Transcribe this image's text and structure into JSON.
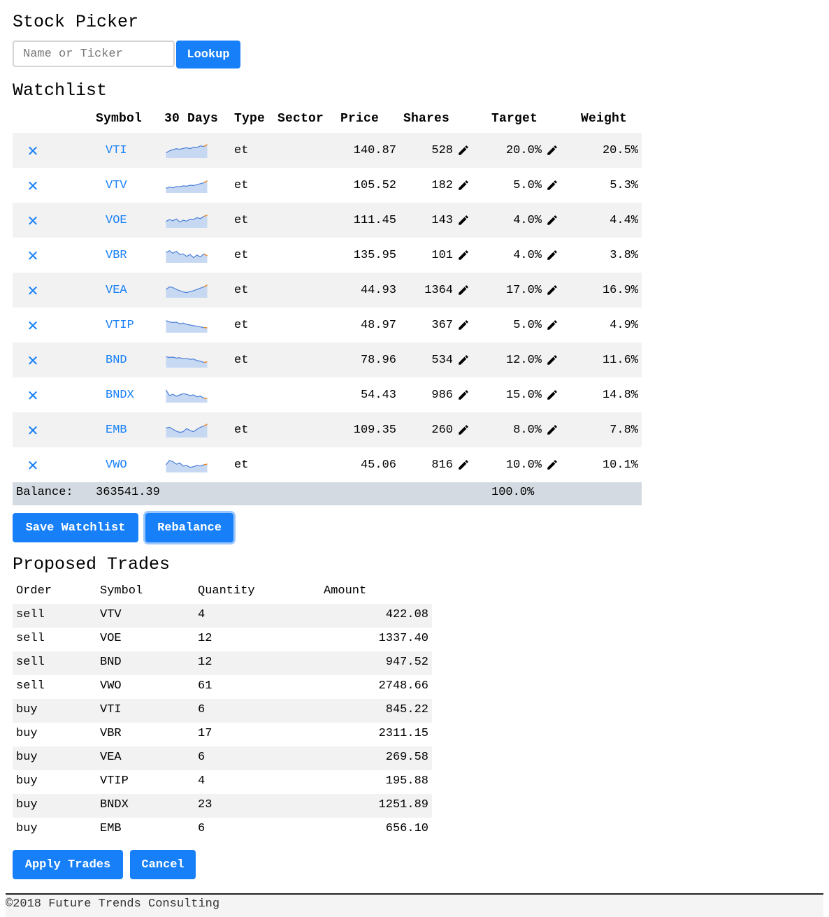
{
  "app": {
    "title": "Stock Picker",
    "search": {
      "placeholder": "Name or Ticker",
      "value": ""
    },
    "lookup_label": "Lookup"
  },
  "watchlist": {
    "title": "Watchlist",
    "columns": [
      "Symbol",
      "30 Days",
      "Type",
      "Sector",
      "Price",
      "Shares",
      "Target",
      "Weight"
    ],
    "rows": [
      {
        "symbol": "VTI",
        "type": "et",
        "price": "140.87",
        "shares": "528",
        "target": "20.0%",
        "weight": "20.5%",
        "spark": [
          0.3,
          0.45,
          0.55,
          0.62,
          0.58,
          0.65,
          0.7,
          0.63,
          0.75,
          0.72,
          0.85,
          0.8,
          0.95
        ]
      },
      {
        "symbol": "VTV",
        "type": "et",
        "price": "105.52",
        "shares": "182",
        "target": "5.0%",
        "weight": "5.3%",
        "spark": [
          0.25,
          0.35,
          0.3,
          0.4,
          0.38,
          0.45,
          0.42,
          0.5,
          0.48,
          0.55,
          0.62,
          0.7,
          0.85
        ]
      },
      {
        "symbol": "VOE",
        "type": "et",
        "price": "111.45",
        "shares": "143",
        "target": "4.0%",
        "weight": "4.4%",
        "spark": [
          0.4,
          0.55,
          0.45,
          0.6,
          0.35,
          0.5,
          0.42,
          0.58,
          0.55,
          0.7,
          0.62,
          0.8,
          0.9
        ]
      },
      {
        "symbol": "VBR",
        "type": "et",
        "price": "135.95",
        "shares": "101",
        "target": "4.0%",
        "weight": "3.8%",
        "spark": [
          0.7,
          0.85,
          0.65,
          0.8,
          0.55,
          0.6,
          0.4,
          0.55,
          0.3,
          0.5,
          0.35,
          0.6,
          0.45
        ]
      },
      {
        "symbol": "VEA",
        "type": "et",
        "price": "44.93",
        "shares": "1364",
        "target": "17.0%",
        "weight": "16.9%",
        "spark": [
          0.55,
          0.75,
          0.7,
          0.55,
          0.45,
          0.35,
          0.3,
          0.38,
          0.45,
          0.55,
          0.65,
          0.75,
          0.9
        ]
      },
      {
        "symbol": "VTIP",
        "type": "et",
        "price": "48.97",
        "shares": "367",
        "target": "5.0%",
        "weight": "4.9%",
        "spark": [
          0.85,
          0.75,
          0.7,
          0.72,
          0.6,
          0.65,
          0.55,
          0.5,
          0.45,
          0.4,
          0.35,
          0.3,
          0.28
        ]
      },
      {
        "symbol": "BND",
        "type": "et",
        "price": "78.96",
        "shares": "534",
        "target": "12.0%",
        "weight": "11.6%",
        "spark": [
          0.75,
          0.7,
          0.72,
          0.65,
          0.68,
          0.6,
          0.62,
          0.55,
          0.58,
          0.45,
          0.4,
          0.3,
          0.35
        ]
      },
      {
        "symbol": "BNDX",
        "type": "",
        "price": "54.43",
        "shares": "986",
        "target": "15.0%",
        "weight": "14.8%",
        "spark": [
          0.9,
          0.45,
          0.55,
          0.4,
          0.5,
          0.6,
          0.55,
          0.45,
          0.5,
          0.35,
          0.4,
          0.25,
          0.2
        ]
      },
      {
        "symbol": "EMB",
        "type": "et",
        "price": "109.35",
        "shares": "260",
        "target": "8.0%",
        "weight": "7.8%",
        "spark": [
          0.65,
          0.7,
          0.55,
          0.4,
          0.3,
          0.35,
          0.6,
          0.45,
          0.35,
          0.55,
          0.7,
          0.8,
          0.95
        ]
      },
      {
        "symbol": "VWO",
        "type": "et",
        "price": "45.06",
        "shares": "816",
        "target": "10.0%",
        "weight": "10.1%",
        "spark": [
          0.5,
          0.85,
          0.75,
          0.55,
          0.65,
          0.4,
          0.45,
          0.3,
          0.35,
          0.45,
          0.4,
          0.5,
          0.55
        ]
      }
    ],
    "balance_label": "Balance:",
    "balance_value": "363541.39",
    "target_total": "100.0%",
    "save_label": "Save Watchlist",
    "rebalance_label": "Rebalance"
  },
  "trades": {
    "title": "Proposed Trades",
    "columns": [
      "Order",
      "Symbol",
      "Quantity",
      "Amount"
    ],
    "rows": [
      {
        "order": "sell",
        "symbol": "VTV",
        "quantity": "4",
        "amount": "422.08"
      },
      {
        "order": "sell",
        "symbol": "VOE",
        "quantity": "12",
        "amount": "1337.40"
      },
      {
        "order": "sell",
        "symbol": "BND",
        "quantity": "12",
        "amount": "947.52"
      },
      {
        "order": "sell",
        "symbol": "VWO",
        "quantity": "61",
        "amount": "2748.66"
      },
      {
        "order": "buy",
        "symbol": "VTI",
        "quantity": "6",
        "amount": "845.22"
      },
      {
        "order": "buy",
        "symbol": "VBR",
        "quantity": "17",
        "amount": "2311.15"
      },
      {
        "order": "buy",
        "symbol": "VEA",
        "quantity": "6",
        "amount": "269.58"
      },
      {
        "order": "buy",
        "symbol": "VTIP",
        "quantity": "4",
        "amount": "195.88"
      },
      {
        "order": "buy",
        "symbol": "BNDX",
        "quantity": "23",
        "amount": "1251.89"
      },
      {
        "order": "buy",
        "symbol": "EMB",
        "quantity": "6",
        "amount": "656.10"
      }
    ],
    "apply_label": "Apply Trades",
    "cancel_label": "Cancel"
  },
  "footer": {
    "text": "©2018 Future Trends Consulting"
  },
  "colors": {
    "accent": "#1780f8",
    "spark_line": "#4a7fd6",
    "spark_fill": "#c7d8f3",
    "spark_end": "#f08a24",
    "row_stripe": "#f2f2f2",
    "balance_bg": "#d3dae1"
  },
  "icons": {
    "remove": "close-icon",
    "edit": "pencil-icon"
  }
}
